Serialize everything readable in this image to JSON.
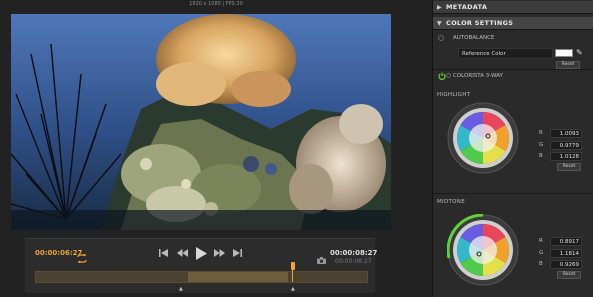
{
  "viewer": {
    "video_info": "1920 x 1080 | FPS:30",
    "timecode_current": "00:00:06:27",
    "timecode_out": "00:00:08:27",
    "timecode_duration": "00:00:08:27",
    "controls": {
      "first_icon": "skip-to-start-icon",
      "rewind_icon": "rewind-icon",
      "play_icon": "play-icon",
      "forward_icon": "fast-forward-icon",
      "last_icon": "skip-to-end-icon",
      "loop_icon": "loop-icon",
      "snapshot_icon": "camera-icon"
    },
    "timeline": {
      "range_start_fraction": 0.46,
      "range_end_fraction": 0.76,
      "playhead_fraction": 0.775
    },
    "marker_in": "▲",
    "marker_out": "▲"
  },
  "panel": {
    "metadata_header": "METADATA",
    "color_settings_header": "COLOR SETTINGS",
    "autobalance_label": "AUTOBALANCE",
    "reference_color_label": "Reference Color",
    "reference_color_value": "#ffffff",
    "reset_label": "Reset",
    "colorista_label": "COLORISTA 3-WAY",
    "highlight": {
      "label": "HIGHLIGHT",
      "r_label": "R",
      "r": "1.0093",
      "g_label": "G",
      "g": "0.9779",
      "b_label": "B",
      "b": "1.0128"
    },
    "midtone": {
      "label": "MIDTONE",
      "r_label": "R",
      "r": "0.8917",
      "g_label": "G",
      "g": "1.1814",
      "b_label": "B",
      "b": "0.9269"
    }
  },
  "colors": {
    "accent_orange": "#f0a629",
    "power_green": "#5fd13a",
    "panel_bg": "#2a2a2a",
    "header_bg": "#3c3c3c"
  }
}
